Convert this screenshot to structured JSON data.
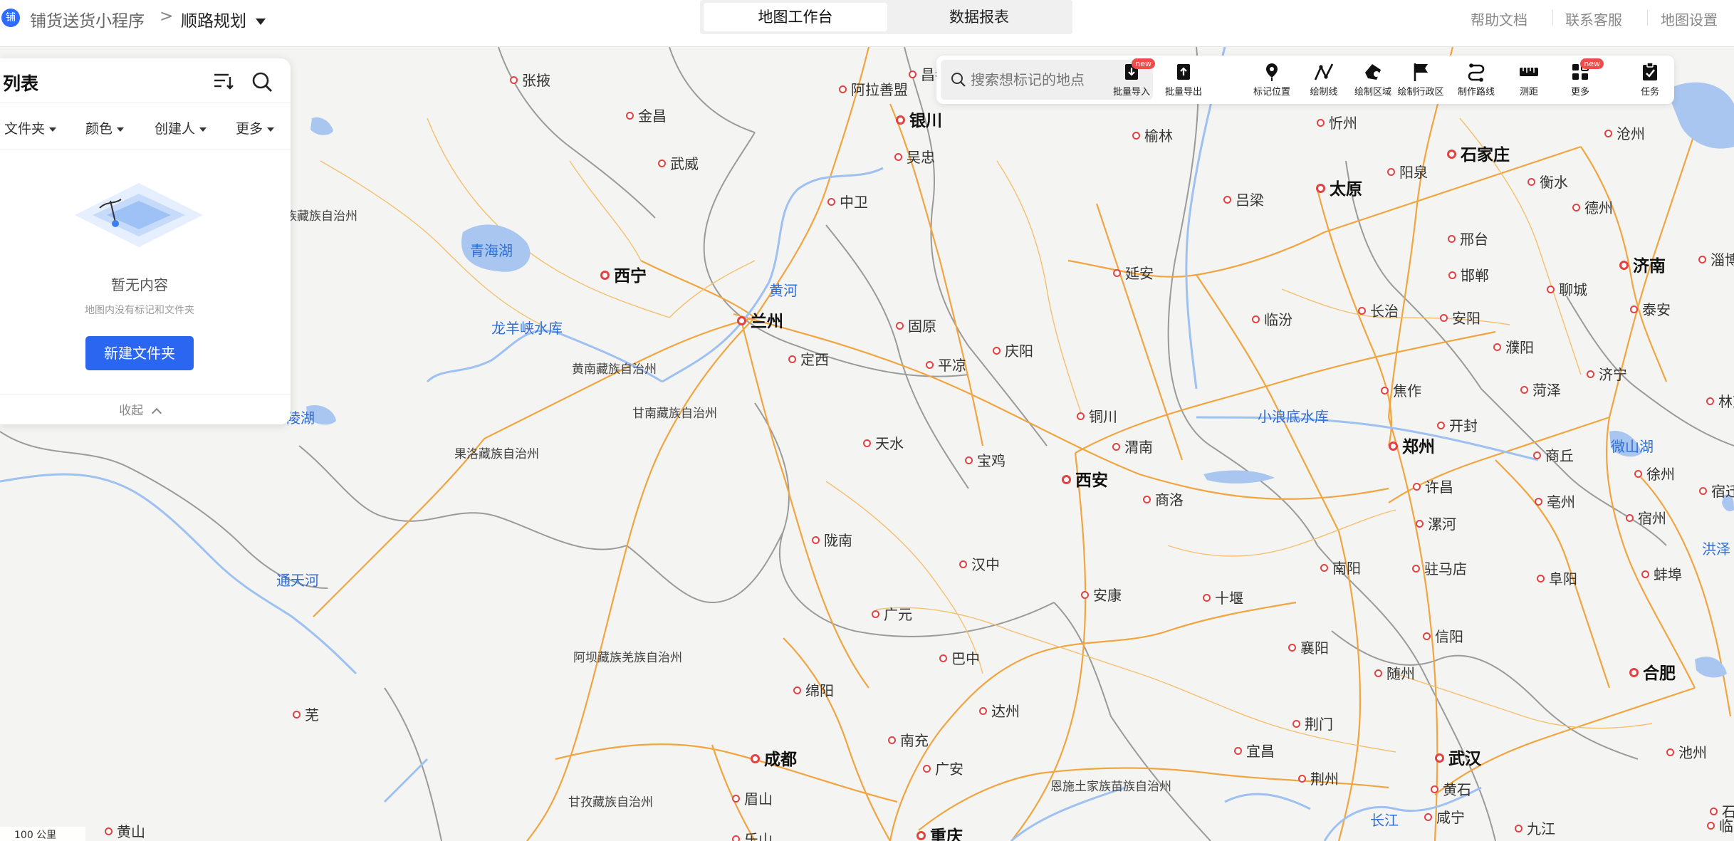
{
  "header": {
    "app_icon_text": "铺",
    "app_name": "铺货送货小程序",
    "separator": ">",
    "project": "顺路规划",
    "tabs": [
      {
        "label": "地图工作台",
        "active": true
      },
      {
        "label": "数据报表",
        "active": false
      }
    ],
    "links": [
      "帮助文档",
      "联系客服",
      "地图设置"
    ]
  },
  "panel": {
    "title": "列表",
    "filters": [
      "文件夹",
      "颜色",
      "创建人",
      "更多"
    ],
    "empty_title": "暂无内容",
    "empty_desc": "地图内没有标记和文件夹",
    "new_folder_button": "新建文件夹",
    "collapse_label": "收起"
  },
  "search": {
    "placeholder": "搜索想标记的地点"
  },
  "toolbar": {
    "tools": [
      {
        "label": "批量导入",
        "icon": "import-icon",
        "badge": "new"
      },
      {
        "label": "批量导出",
        "icon": "export-icon",
        "badge": ""
      },
      {
        "label": "标记位置",
        "icon": "pin-icon",
        "badge": ""
      },
      {
        "label": "绘制线",
        "icon": "draw-line-icon",
        "badge": ""
      },
      {
        "label": "绘制区域",
        "icon": "draw-area-icon",
        "badge": ""
      },
      {
        "label": "绘制行政区",
        "icon": "flag-icon",
        "badge": ""
      },
      {
        "label": "制作路线",
        "icon": "route-icon",
        "badge": ""
      },
      {
        "label": "测距",
        "icon": "ruler-icon",
        "badge": ""
      },
      {
        "label": "更多",
        "icon": "grid-icon",
        "badge": "new"
      },
      {
        "label": "任务",
        "icon": "task-icon",
        "badge": ""
      }
    ]
  },
  "scale": {
    "label": "100 公里"
  },
  "map": {
    "cities_major": [
      "银川",
      "西宁",
      "兰州",
      "太原",
      "石家庄",
      "济南",
      "西安",
      "郑州",
      "成都",
      "武汉",
      "合肥",
      "重庆"
    ],
    "cities": [
      "张掖",
      "金昌",
      "武威",
      "阿拉善盟",
      "吴忠",
      "中卫",
      "忻州",
      "榆林",
      "阳泉",
      "吕梁",
      "衡水",
      "德州",
      "沧州",
      "邢台",
      "邯郸",
      "聊城",
      "淄博",
      "泰安",
      "延安",
      "临汾",
      "长治",
      "安阳",
      "濮阳",
      "济宁",
      "固原",
      "庆阳",
      "平凉",
      "定西",
      "铜川",
      "渭南",
      "天水",
      "宝鸡",
      "商洛",
      "焦作",
      "开封",
      "菏泽",
      "商丘",
      "徐州",
      "宿迁",
      "许昌",
      "亳州",
      "漯河",
      "宿州",
      "陇南",
      "汉中",
      "安康",
      "十堰",
      "南阳",
      "驻马店",
      "阜阳",
      "蚌埠",
      "广元",
      "巴中",
      "襄阳",
      "信阳",
      "绵阳",
      "达州",
      "随州",
      "南充",
      "荆门",
      "广安",
      "宜昌",
      "荆州",
      "眉山",
      "黄石",
      "池州",
      "乐山",
      "咸宁",
      "九江",
      "昌都",
      "林芝",
      "石",
      "临",
      "芜",
      "黄山"
    ],
    "regions": [
      "族藏族自治州",
      "黄南藏族自治州",
      "甘南藏族自治州",
      "果洛藏族自治州",
      "阿坝藏族羌族自治州",
      "恩施土家族苗族自治州",
      "甘孜藏族自治州"
    ],
    "water": [
      "青海湖",
      "黄河",
      "龙羊峡水库",
      "陵湖",
      "通天河",
      "小浪底水库",
      "微山湖",
      "洪泽",
      "长江"
    ]
  }
}
